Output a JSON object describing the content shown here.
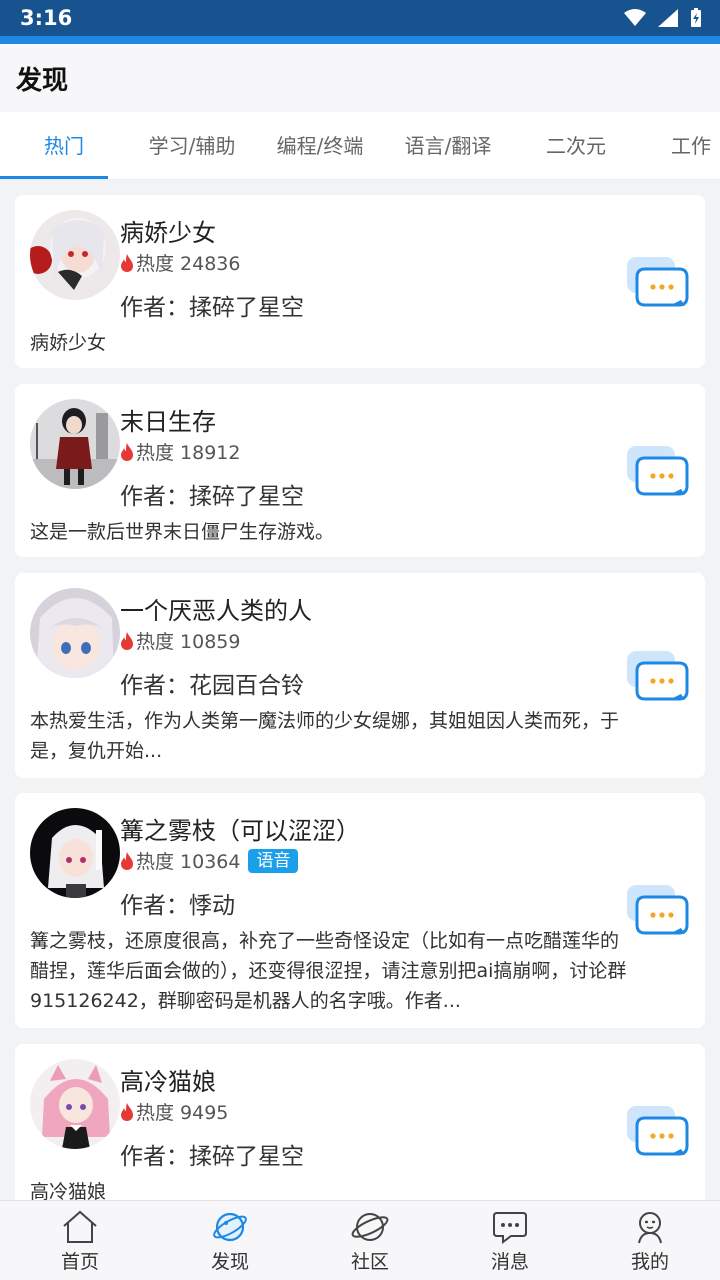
{
  "status_bar": {
    "time": "3:16"
  },
  "header": {
    "title": "发现"
  },
  "tabs": [
    {
      "label": "热门"
    },
    {
      "label": "学习/辅助"
    },
    {
      "label": "编程/终端"
    },
    {
      "label": "语言/翻译"
    },
    {
      "label": "二次元"
    },
    {
      "label": "工作"
    }
  ],
  "cards": [
    {
      "name": "病娇少女",
      "heat": "热度 24836",
      "author": "作者：揉碎了星空",
      "description": "病娇少女",
      "badge": ""
    },
    {
      "name": "末日生存",
      "heat": "热度 18912",
      "author": "作者：揉碎了星空",
      "description": "这是一款后世界末日僵尸生存游戏。",
      "badge": ""
    },
    {
      "name": "一个厌恶人类的人",
      "heat": "热度 10859",
      "author": "作者：花园百合铃",
      "description": "本热爱生活，作为人类第一魔法师的少女缇娜，其姐姐因人类而死，于是，复仇开始...",
      "badge": ""
    },
    {
      "name": "篝之雾枝（可以涩涩）",
      "heat": "热度 10364",
      "author": "作者：悸动",
      "description": "篝之雾枝，还原度很高，补充了一些奇怪设定（比如有一点吃醋莲华的醋捏，莲华后面会做的），还变得很涩捏，请注意别把ai搞崩啊，讨论群915126242，群聊密码是机器人的名字哦。作者...",
      "badge": "语音"
    },
    {
      "name": "高冷猫娘",
      "heat": "热度 9495",
      "author": "作者：揉碎了星空",
      "description": "高冷猫娘",
      "badge": ""
    }
  ],
  "bottom_nav": [
    {
      "label": "首页",
      "icon": "home-icon"
    },
    {
      "label": "发现",
      "icon": "planet-icon"
    },
    {
      "label": "社区",
      "icon": "globe-icon"
    },
    {
      "label": "消息",
      "icon": "message-icon"
    },
    {
      "label": "我的",
      "icon": "profile-icon"
    }
  ],
  "colors": {
    "accent": "#1e88e5",
    "status_bar": "#17538f",
    "badge": "#1aa0ea",
    "flame": "#e53935"
  }
}
